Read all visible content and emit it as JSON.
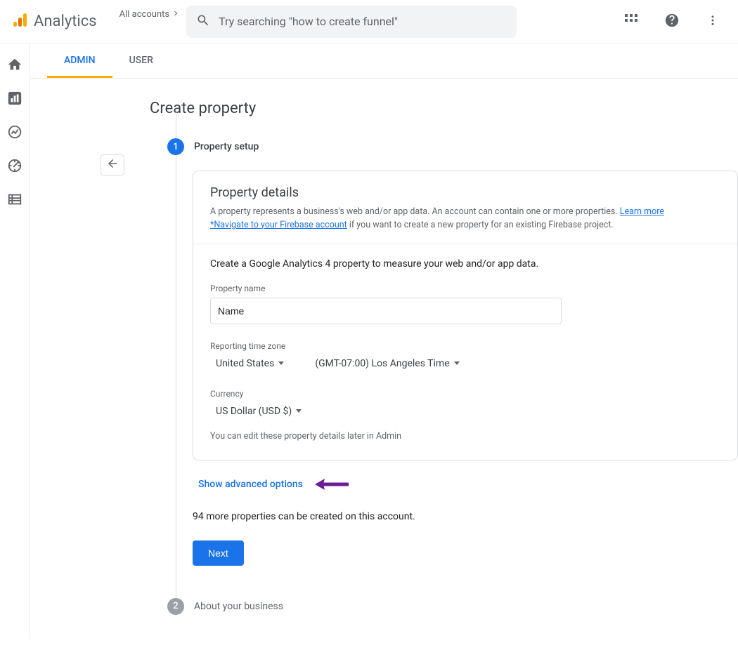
{
  "header": {
    "product_name": "Analytics",
    "accounts_link": "All accounts",
    "search_placeholder": "Try searching \"how to create funnel\""
  },
  "tabs": {
    "admin": "ADMIN",
    "user": "USER"
  },
  "page": {
    "title": "Create property"
  },
  "step1": {
    "number": "1",
    "label": "Property setup"
  },
  "step2": {
    "number": "2",
    "label": "About your business"
  },
  "card": {
    "title": "Property details",
    "sub_a": "A property represents a business's web and/or app data. An account can contain one or more properties. ",
    "learn_more": "Learn more",
    "firebase_link": "*Navigate to your Firebase account",
    "sub_b": " if you want to create a new property for an existing Firebase project.",
    "lead": "Create a Google Analytics 4 property to measure your web and/or app data.",
    "property_name_label": "Property name",
    "property_name_value": "Name",
    "tz_label": "Reporting time zone",
    "tz_country": "United States",
    "tz_value": "(GMT-07:00) Los Angeles Time",
    "currency_label": "Currency",
    "currency_value": "US Dollar (USD $)",
    "hint": "You can edit these property details later in Admin"
  },
  "advanced_link": "Show advanced options",
  "more_properties": "94 more properties can be created on this account.",
  "next_button": "Next"
}
